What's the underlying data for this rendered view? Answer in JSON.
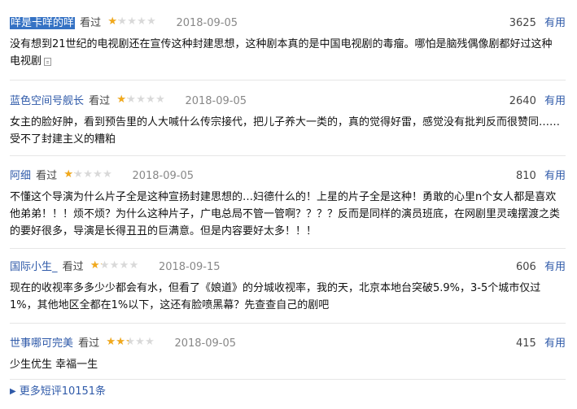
{
  "comments": [
    {
      "user": "咩是卡咩的咩",
      "viewed": "看过",
      "rating": 1,
      "date": "2018-09-05",
      "votes": "3625",
      "useful": "有用",
      "text": "没有想到21世纪的电视剧还在宣传这种封建思想，这种剧本真的是中国电视剧的毒瘤。哪怕是脑残偶像剧都好过这种电视剧",
      "has_expand": true,
      "expand_icon": "expand-icon"
    },
    {
      "user": "蓝色空间号舰长",
      "viewed": "看过",
      "rating": 1,
      "date": "2018-09-05",
      "votes": "2640",
      "useful": "有用",
      "text": "女主的脸好肿，看到预告里的人大喊什么传宗接代，把儿子养大一类的，真的觉得好雷，感觉没有批判反而很赞同……受不了封建主义的糟粕"
    },
    {
      "user": "阿细",
      "viewed": "看过",
      "rating": 1,
      "date": "2018-09-05",
      "votes": "810",
      "useful": "有用",
      "text": "不懂这个导演为什么片子全是这种宣扬封建思想的…妇德什么的！上星的片子全是这种！勇敢的心里n个女人都是喜欢他弟弟！！！烦不烦？为什么这种片子，广电总局不管一管啊？？？？反而是同样的演员班底，在网剧里灵魂摆渡之类的要好很多，导演是长得丑丑的巨满意。但是内容要好太多！！！"
    },
    {
      "user": "国际小生_",
      "viewed": "看过",
      "rating": 1,
      "date": "2018-09-15",
      "votes": "606",
      "useful": "有用",
      "text": "现在的收视率多多少少都会有水，但看了《娘道》的分城收视率，我的天，北京本地台突破5.9%，3-5个城市仅过1%，其他地区全都在1%以下，这还有脸喷黑幕？先查查自己的剧吧"
    },
    {
      "user": "世事哪可完美",
      "viewed": "看过",
      "rating": 2,
      "date": "2018-09-05",
      "votes": "415",
      "useful": "有用",
      "text": "少生优生 幸福一生"
    }
  ],
  "more": {
    "arrow": "▶",
    "label": "更多短评10151条"
  },
  "colors": {
    "link": "#2f5aa9",
    "star": "#f2a91b",
    "star_empty": "#d9d9d9",
    "selection": "#3572c4"
  },
  "icons": {
    "star": "star-icon",
    "expand": "expand-icon",
    "arrow": "arrow-right-icon"
  }
}
